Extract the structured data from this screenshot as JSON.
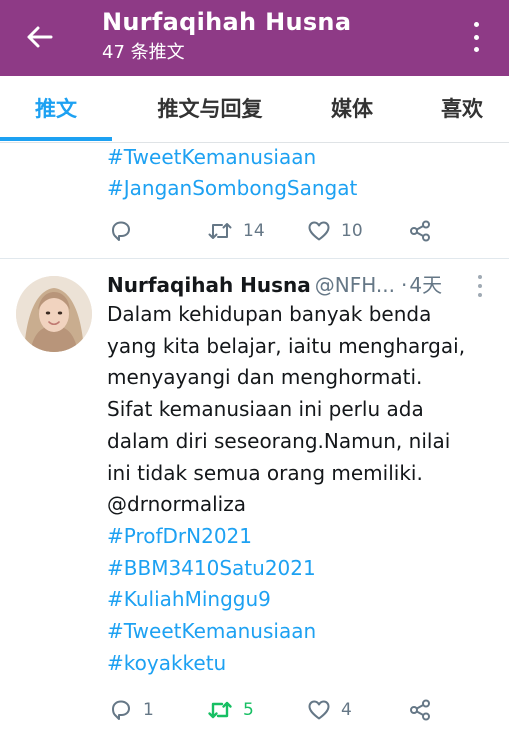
{
  "header": {
    "title": "Nurfaqihah Husna",
    "subtitle": "47 条推文",
    "bg_color": "#8e3a86"
  },
  "tabs": [
    {
      "label": "推文",
      "active": true
    },
    {
      "label": "推文与回复",
      "active": false
    },
    {
      "label": "媒体",
      "active": false
    },
    {
      "label": "喜欢",
      "active": false
    }
  ],
  "previous_tweet": {
    "lines": [
      "#TweetKemanusiaan",
      "#JanganSombongSangat"
    ],
    "reply_count": "",
    "retweet_count": "14",
    "like_count": "10"
  },
  "tweet": {
    "author_name": "Nurfaqihah Husna",
    "handle": "@NFH...",
    "dot": "·",
    "time": "4天",
    "text_lines": [
      "Dalam kehidupan banyak benda",
      "yang kita belajar, iaitu menghargai,",
      "menyayangi dan menghormati.",
      "Sifat kemanusiaan ini perlu ada",
      "dalam diri seseorang.Namun, nilai",
      "ini tidak semua orang memiliki."
    ],
    "mention": "@drnormaliza",
    "hashtags": [
      "#ProfDrN2021",
      "#BBM3410Satu2021",
      "#KuliahMinggu9",
      "#TweetKemanusiaan",
      "#koyakketu"
    ],
    "reply_count": "1",
    "retweet_count": "5",
    "like_count": "4",
    "retweeted": true
  },
  "colors": {
    "accent": "#1da1f2",
    "retweet_active": "#17bf63",
    "muted": "#657786"
  },
  "icons": [
    "back-arrow-icon",
    "more-vertical-icon",
    "reply-icon",
    "retweet-icon",
    "like-icon",
    "share-icon",
    "tweet-menu-icon"
  ]
}
